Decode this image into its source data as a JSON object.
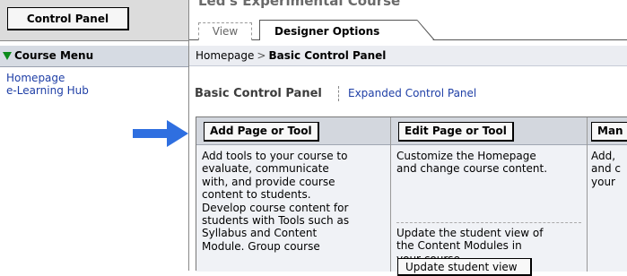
{
  "sidebar": {
    "control_panel_label": "Control Panel",
    "course_menu_label": "Course Menu",
    "links": [
      "Homepage",
      "e-Learning Hub"
    ]
  },
  "header": {
    "course_title": "Led's Experimental Course",
    "tabs": [
      {
        "label": "View",
        "active": false
      },
      {
        "label": "Designer Options",
        "active": true
      }
    ]
  },
  "breadcrumb": {
    "home": "Homepage",
    "separator": ">",
    "current": "Basic Control Panel"
  },
  "page": {
    "heading": "Basic Control Panel",
    "alt_link": "Expanded Control Panel"
  },
  "tools": [
    {
      "button": "Add Page or Tool",
      "description": "Add tools to your course to\nevaluate, communicate\nwith, and provide course\ncontent to students.\nDevelop course content for\nstudents with Tools such as\nSyllabus and Content\nModule. Group course"
    },
    {
      "button": "Edit Page or Tool",
      "description": "Customize the Homepage\nand change course content.",
      "description2": "Update the student view of\nthe Content Modules in\nyour course.",
      "secondary_button": "Update student view"
    },
    {
      "button": "Man",
      "description": "Add,\nand c\nyour"
    }
  ],
  "colors": {
    "link": "#1f3fa6",
    "arrow": "#2f6fe0",
    "menu_triangle": "#0a8a1a",
    "table_header": "#d3d7de",
    "table_body": "#f0f2f6"
  }
}
